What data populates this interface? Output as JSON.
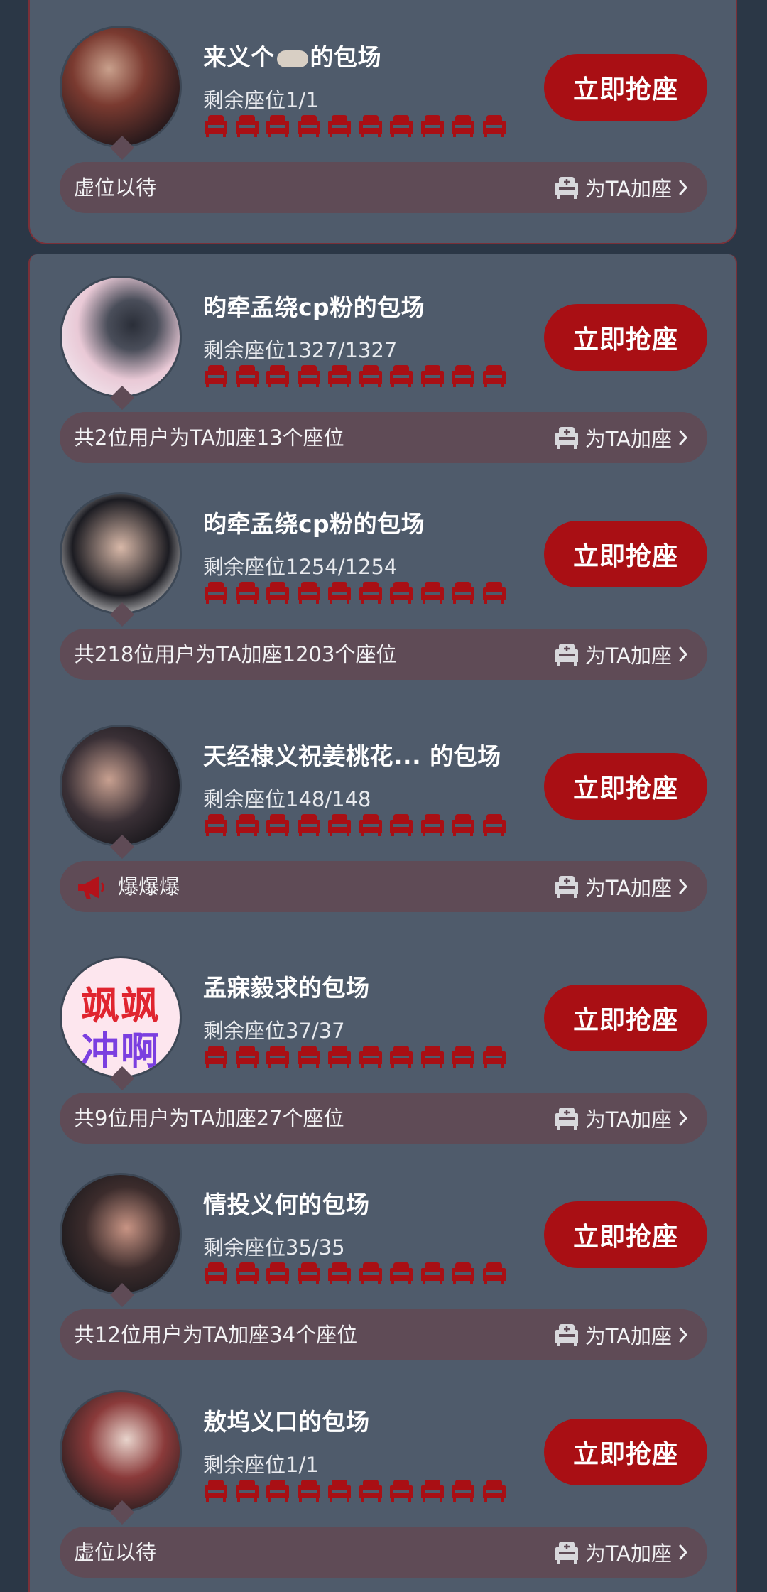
{
  "grab_label": "立即抢座",
  "add_seat_label": "为TA加座",
  "colors": {
    "accent": "#a90f14",
    "seat": "#a90f14",
    "card": "#4f5b6b",
    "bar": "#5f4b56"
  },
  "rooms": [
    {
      "title": "来义个",
      "title_emoji": "dumpling-emoji",
      "title_suffix": "的包场",
      "remaining": "剩余座位1/1",
      "bar_text": "虚位以待",
      "bar_icon": ""
    },
    {
      "title": "昀牵孟绕cp粉的包场",
      "remaining": "剩余座位1327/1327",
      "bar_text": "共2位用户为TA加座13个座位",
      "bar_icon": ""
    },
    {
      "title": "昀牵孟绕cp粉的包场",
      "remaining": "剩余座位1254/1254",
      "bar_text": "共218位用户为TA加座1203个座位",
      "bar_icon": ""
    },
    {
      "title": "天经棣义祝姜桃花... 的包场",
      "remaining": "剩余座位148/148",
      "bar_text": "爆爆爆",
      "bar_icon": "megaphone-icon"
    },
    {
      "title": "孟寐毅求的包场",
      "remaining": "剩余座位37/37",
      "bar_text": "共9位用户为TA加座27个座位",
      "bar_icon": "",
      "avatar_text": [
        "飒飒",
        "冲啊"
      ]
    },
    {
      "title": "情投义何的包场",
      "remaining": "剩余座位35/35",
      "bar_text": "共12位用户为TA加座34个座位",
      "bar_icon": ""
    },
    {
      "title": "敖坞义口的包场",
      "remaining": "剩余座位1/1",
      "bar_text": "虚位以待",
      "bar_icon": ""
    }
  ]
}
